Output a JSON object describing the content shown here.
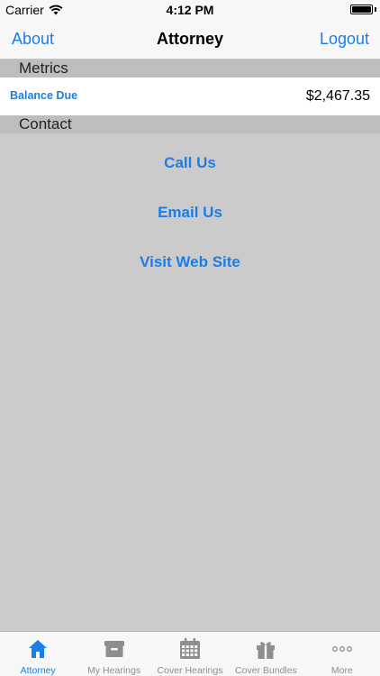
{
  "status_bar": {
    "carrier": "Carrier",
    "time": "4:12 PM"
  },
  "nav": {
    "left": "About",
    "title": "Attorney",
    "right": "Logout"
  },
  "sections": {
    "metrics": "Metrics",
    "contact": "Contact"
  },
  "metrics": {
    "balance_label": "Balance Due",
    "balance_value": "$2,467.35"
  },
  "contact": {
    "call": "Call Us",
    "email": "Email Us",
    "visit": "Visit Web Site"
  },
  "tabs": [
    {
      "label": "Attorney",
      "icon": "house-icon",
      "active": true
    },
    {
      "label": "My Hearings",
      "icon": "archive-box-icon",
      "active": false
    },
    {
      "label": "Cover Hearings",
      "icon": "calendar-icon",
      "active": false
    },
    {
      "label": "Cover Bundles",
      "icon": "gift-icon",
      "active": false
    },
    {
      "label": "More",
      "icon": "more-dots-icon",
      "active": false
    }
  ],
  "colors": {
    "accent": "#1a7ee8",
    "background": "#cbcbcb",
    "section_header": "#bdbdbd",
    "inactive_tab": "#8e8e8e"
  }
}
